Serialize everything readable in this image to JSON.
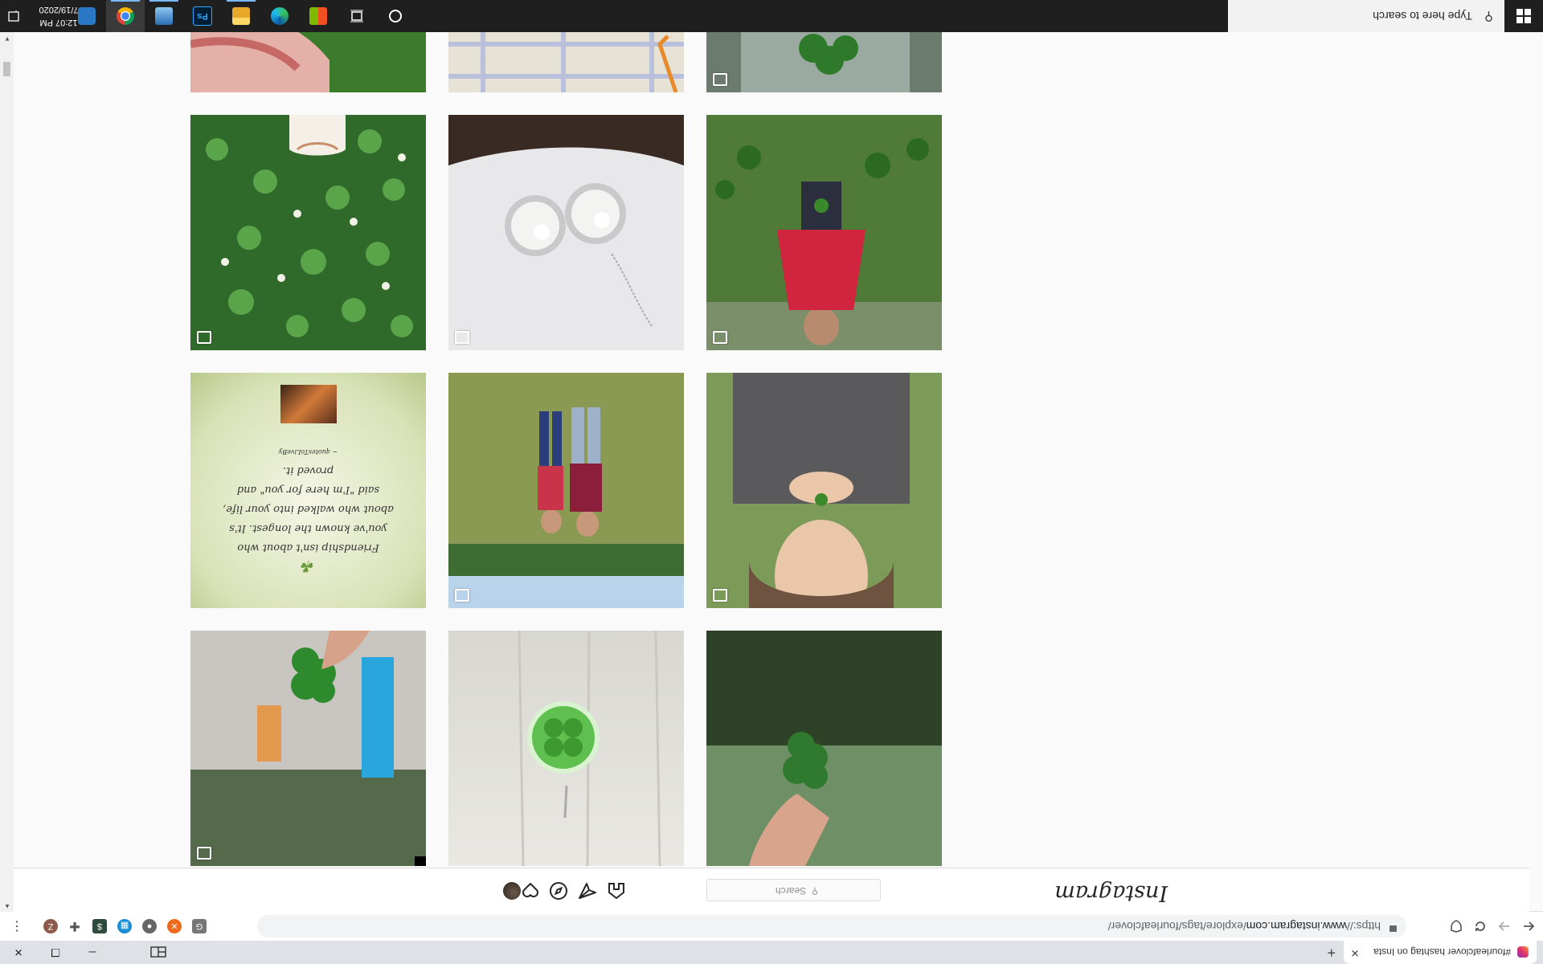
{
  "browser": {
    "tab_title": "#fourleafclover hashtag on Insta",
    "new_tab_label": "+",
    "tab_close_label": "✕",
    "url_scheme": "https://",
    "url_host": "www.instagram.com",
    "url_path": "/explore/tags/fourleafclover/",
    "profile_initial": "Z",
    "minimize_label": "─",
    "restore_label": "❐",
    "close_label": "✕",
    "menu_label": "⋮"
  },
  "instagram": {
    "logo_text": "Instagram",
    "search_placeholder": "Search",
    "search_icon": "search-icon",
    "nav_icons": [
      "home-icon",
      "direct-icon",
      "explore-icon",
      "activity-icon",
      "profile-avatar"
    ]
  },
  "grid": {
    "rows": [
      {
        "tiles": [
          "clover-in-fingers",
          "tablecloth",
          "clover-in-glass"
        ]
      },
      {
        "tiles": [
          "clover-field-sneaker",
          "pearl-earrings",
          "girl-in-clover"
        ]
      },
      {
        "tiles": [
          "friendship-quote",
          "two-kids-on-grass",
          "woman-holding-clover"
        ]
      },
      {
        "tiles": [
          "clover-against-building",
          "clover-resin-pendant",
          "clover-against-trees"
        ]
      }
    ],
    "quote_text": "Friendship isn't about who you've known the longest. It's about who walked into your life, said \"I'm here for you\" and proved it.",
    "quote_credit": "~ quotesToLiveBy"
  },
  "taskbar": {
    "search_placeholder": "Type here to search",
    "time": "12:07 PM",
    "date": "7/19/2020",
    "apps": [
      "task-view-icon",
      "microsoft-store-icon",
      "edge-icon",
      "file-explorer-icon",
      "photoshop-icon",
      "weather-app-icon",
      "chrome-icon",
      "settings-icon"
    ],
    "photoshop_label": "Ps"
  }
}
